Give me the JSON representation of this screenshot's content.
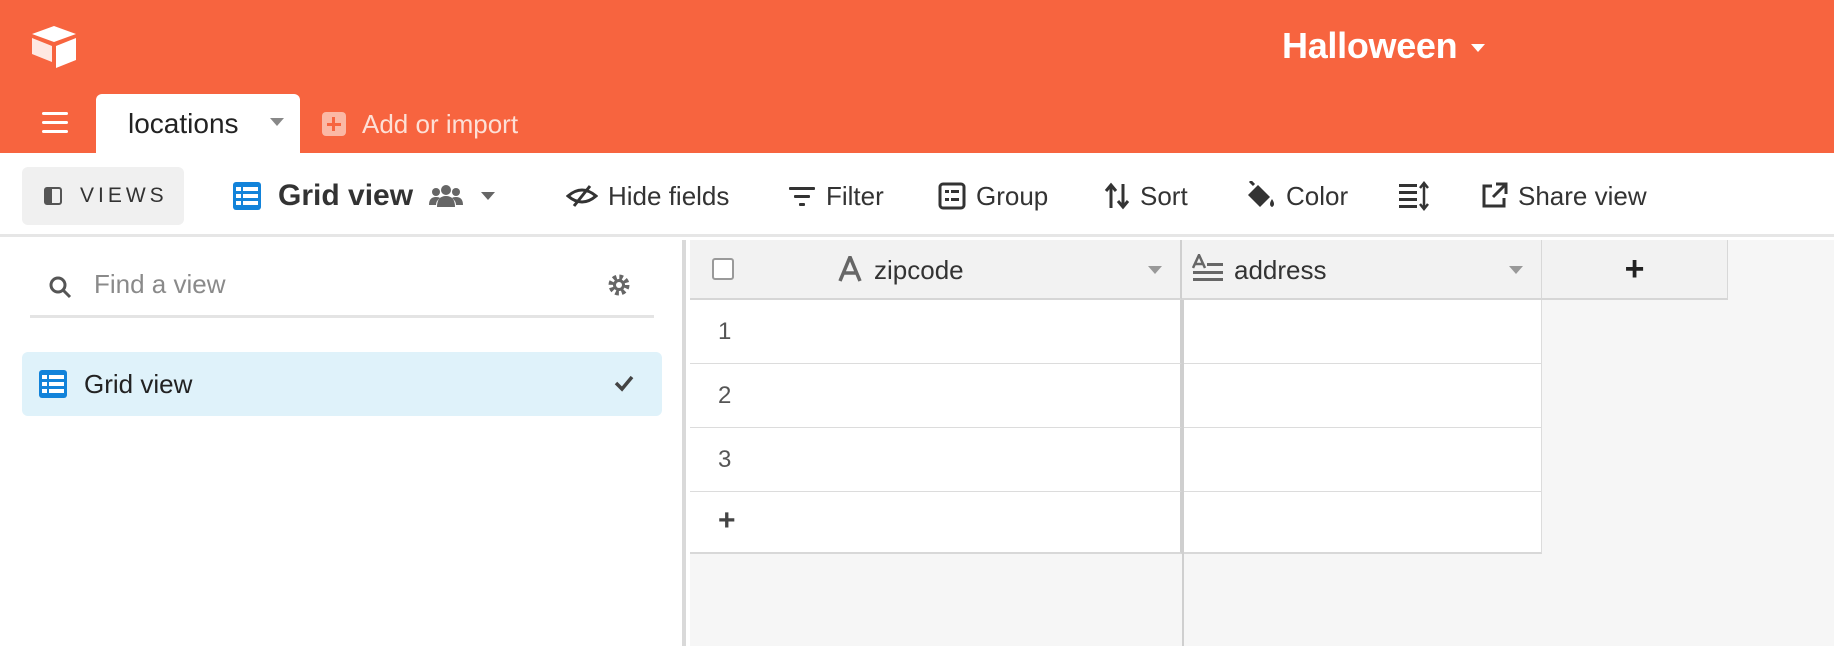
{
  "app": {
    "logo_icon": "airtable-logo-icon",
    "base_title": "Halloween",
    "accent_color": "#f7643f"
  },
  "tabs": {
    "menu_icon": "hamburger-icon",
    "active_table": "locations",
    "add_import_label": "Add or import"
  },
  "toolbar": {
    "views_label": "VIEWS",
    "current_view": "Grid view",
    "hide_fields": "Hide fields",
    "filter": "Filter",
    "group": "Group",
    "sort": "Sort",
    "color": "Color",
    "share_view": "Share view"
  },
  "sidebar": {
    "search_placeholder": "Find a view",
    "views": [
      {
        "label": "Grid view",
        "selected": true
      }
    ]
  },
  "grid": {
    "columns": [
      {
        "name": "zipcode",
        "type_icon": "single-line-text-icon"
      },
      {
        "name": "address",
        "type_icon": "long-text-icon"
      }
    ],
    "add_field_label": "+",
    "rows": [
      "1",
      "2",
      "3"
    ],
    "add_row_label": "+"
  }
}
